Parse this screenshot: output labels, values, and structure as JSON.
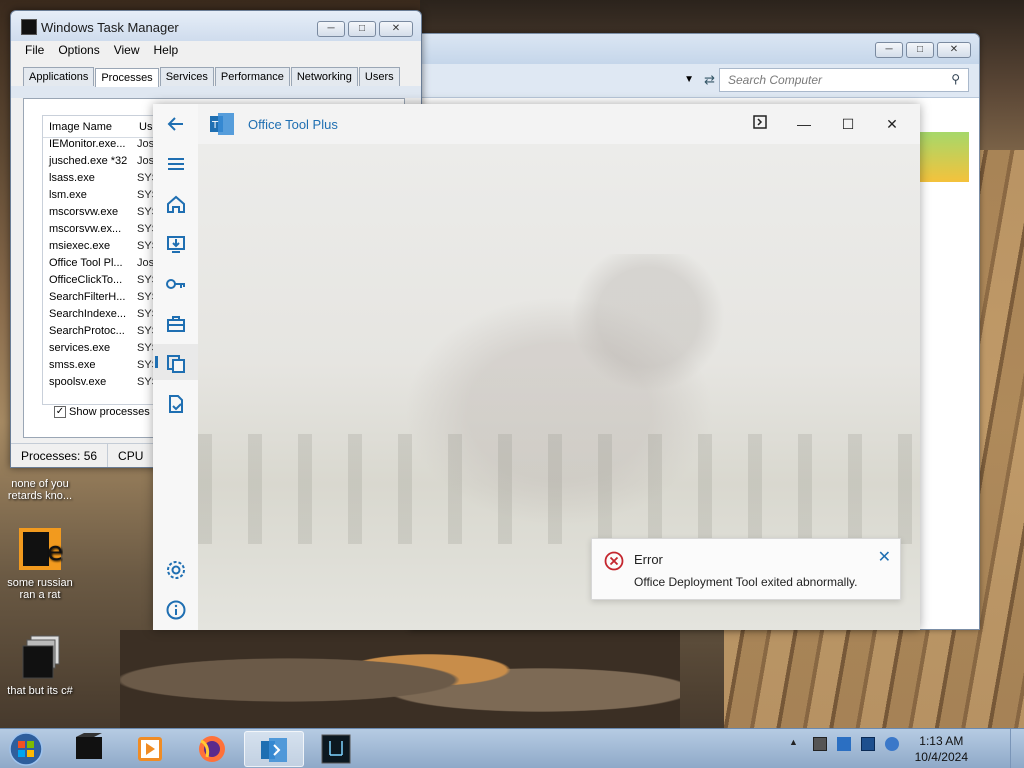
{
  "desktop": {
    "icons": [
      {
        "label": "none of you retards kno..."
      },
      {
        "label": "some russian ran a rat"
      },
      {
        "label": "that but its c#"
      }
    ]
  },
  "explorer": {
    "search_placeholder": "Search Computer"
  },
  "task_manager": {
    "title": "Windows Task Manager",
    "menu": [
      "File",
      "Options",
      "View",
      "Help"
    ],
    "tabs": [
      "Applications",
      "Processes",
      "Services",
      "Performance",
      "Networking",
      "Users"
    ],
    "active_tab": "Processes",
    "columns": [
      "Image Name",
      "Use"
    ],
    "processes": [
      {
        "name": "IEMonitor.exe...",
        "user": "Jos"
      },
      {
        "name": "jusched.exe *32",
        "user": "Jos"
      },
      {
        "name": "lsass.exe",
        "user": "SYS"
      },
      {
        "name": "lsm.exe",
        "user": "SYS"
      },
      {
        "name": "mscorsvw.exe",
        "user": "SYS"
      },
      {
        "name": "mscorsvw.ex...",
        "user": "SYS"
      },
      {
        "name": "msiexec.exe",
        "user": "SYS"
      },
      {
        "name": "Office Tool Pl...",
        "user": "Jos"
      },
      {
        "name": "OfficeClickTo...",
        "user": "SYS"
      },
      {
        "name": "SearchFilterH...",
        "user": "SYS"
      },
      {
        "name": "SearchIndexe...",
        "user": "SYS"
      },
      {
        "name": "SearchProtoc...",
        "user": "SYS"
      },
      {
        "name": "services.exe",
        "user": "SYS"
      },
      {
        "name": "smss.exe",
        "user": "SYS"
      },
      {
        "name": "spoolsv.exe",
        "user": "SYS"
      }
    ],
    "show_all_label": "Show processes fro",
    "status": {
      "processes": "Processes: 56",
      "cpu": "CPU"
    }
  },
  "office_tool": {
    "title": "Office Tool Plus",
    "nav_icons": [
      "back-arrow-icon",
      "hamburger-menu-icon",
      "home-icon",
      "deploy-icon",
      "key-icon",
      "toolbox-icon",
      "convert-icon",
      "document-check-icon",
      "settings-icon",
      "info-icon"
    ],
    "header_buttons": [
      "console-icon",
      "minimize-icon",
      "maximize-icon",
      "close-icon"
    ],
    "toast": {
      "title": "Error",
      "message": "Office Deployment Tool exited abnormally."
    },
    "accent_color": "#1f6fb2"
  },
  "taskbar": {
    "clock_time": "1:13 AM",
    "clock_date": "10/4/2024"
  }
}
